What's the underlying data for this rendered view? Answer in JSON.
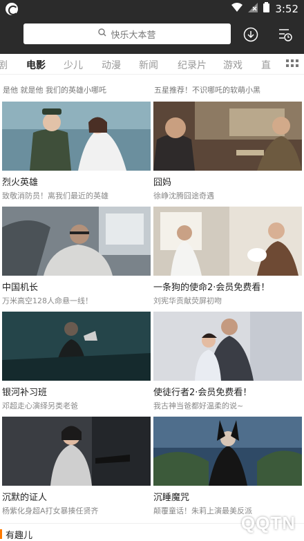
{
  "status": {
    "time": "3:52"
  },
  "header": {
    "search_placeholder": "快乐大本营"
  },
  "tabs": [
    "剧",
    "电影",
    "少儿",
    "动漫",
    "新闻",
    "纪录片",
    "游戏",
    "直"
  ],
  "top_captions": [
    "是他 就是他 我们的英雄小哪吒",
    "五星推荐！不识哪吒的软萌小黑"
  ],
  "cards": [
    {
      "title": "烈火英雄",
      "subtitle": "致敬消防员！离我们最近的英雄"
    },
    {
      "title": "囧妈",
      "subtitle": "徐峥沈腾囧途奇遇"
    },
    {
      "title": "中国机长",
      "subtitle": "万米高空128人命悬一线！"
    },
    {
      "title": "一条狗的使命2·会员免费看！",
      "subtitle": "刘宪华贡献荧屏初吻"
    },
    {
      "title": "银河补习班",
      "subtitle": "邓超走心演绎另类老爸"
    },
    {
      "title": "使徒行者2·会员免费看！",
      "subtitle": "我古神当爸都好温柔的说~"
    },
    {
      "title": "沉默的证人",
      "subtitle": "杨紫化身超A打女暴揍任贤齐"
    },
    {
      "title": "沉睡魔咒",
      "subtitle": "颠覆童话！朱莉上演最美反派"
    }
  ],
  "section": {
    "label": "有趣儿"
  },
  "watermark": {
    "text": "QQTN",
    "small": "腾牛网"
  }
}
